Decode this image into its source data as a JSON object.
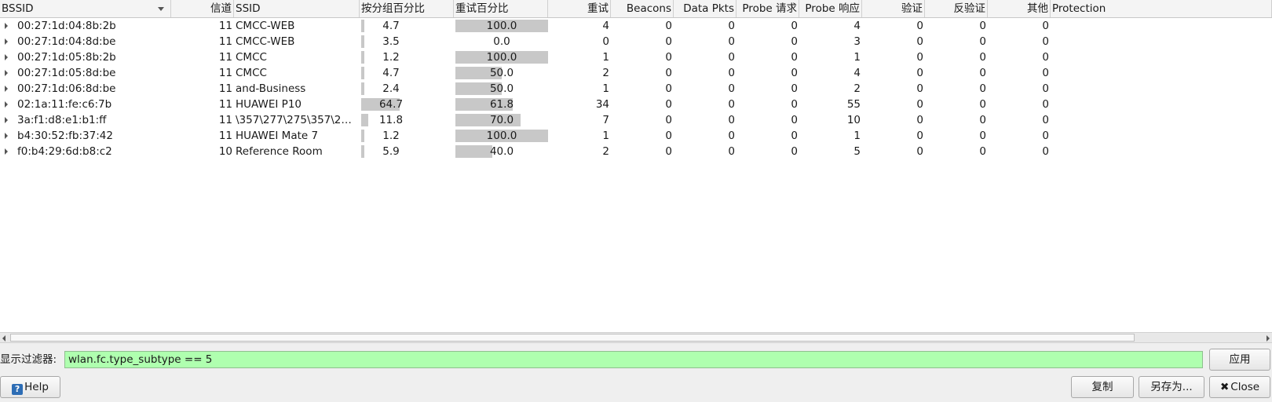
{
  "columns": [
    {
      "key": "bssid",
      "label": "BSSID"
    },
    {
      "key": "channel",
      "label": "信道"
    },
    {
      "key": "ssid",
      "label": "SSID"
    },
    {
      "key": "pct_packets",
      "label": "按分组百分比"
    },
    {
      "key": "pct_retry",
      "label": "重试百分比"
    },
    {
      "key": "retry",
      "label": "重试"
    },
    {
      "key": "beacons",
      "label": "Beacons"
    },
    {
      "key": "data_pkts",
      "label": "Data Pkts"
    },
    {
      "key": "probe_req",
      "label": "Probe 请求"
    },
    {
      "key": "probe_resp",
      "label": "Probe 响应"
    },
    {
      "key": "auth",
      "label": "验证"
    },
    {
      "key": "deauth",
      "label": "反验证"
    },
    {
      "key": "other",
      "label": "其他"
    },
    {
      "key": "protection",
      "label": "Protection"
    }
  ],
  "rows": [
    {
      "bssid": "00:27:1d:04:8b:2b",
      "channel": "11",
      "ssid": "CMCC-WEB",
      "pct_packets": "4.7",
      "pct_packets_value": 4.7,
      "pct_retry": "100.0",
      "pct_retry_value": 100.0,
      "retry": "4",
      "beacons": "0",
      "data_pkts": "0",
      "probe_req": "0",
      "probe_resp": "4",
      "auth": "0",
      "deauth": "0",
      "other": "0",
      "protection": ""
    },
    {
      "bssid": "00:27:1d:04:8d:be",
      "channel": "11",
      "ssid": "CMCC-WEB",
      "pct_packets": "3.5",
      "pct_packets_value": 3.5,
      "pct_retry": "0.0",
      "pct_retry_value": 0.0,
      "retry": "0",
      "beacons": "0",
      "data_pkts": "0",
      "probe_req": "0",
      "probe_resp": "3",
      "auth": "0",
      "deauth": "0",
      "other": "0",
      "protection": ""
    },
    {
      "bssid": "00:27:1d:05:8b:2b",
      "channel": "11",
      "ssid": "CMCC",
      "pct_packets": "1.2",
      "pct_packets_value": 1.2,
      "pct_retry": "100.0",
      "pct_retry_value": 100.0,
      "retry": "1",
      "beacons": "0",
      "data_pkts": "0",
      "probe_req": "0",
      "probe_resp": "1",
      "auth": "0",
      "deauth": "0",
      "other": "0",
      "protection": ""
    },
    {
      "bssid": "00:27:1d:05:8d:be",
      "channel": "11",
      "ssid": "CMCC",
      "pct_packets": "4.7",
      "pct_packets_value": 4.7,
      "pct_retry": "50.0",
      "pct_retry_value": 50.0,
      "retry": "2",
      "beacons": "0",
      "data_pkts": "0",
      "probe_req": "0",
      "probe_resp": "4",
      "auth": "0",
      "deauth": "0",
      "other": "0",
      "protection": ""
    },
    {
      "bssid": "00:27:1d:06:8d:be",
      "channel": "11",
      "ssid": "and-Business",
      "pct_packets": "2.4",
      "pct_packets_value": 2.4,
      "pct_retry": "50.0",
      "pct_retry_value": 50.0,
      "retry": "1",
      "beacons": "0",
      "data_pkts": "0",
      "probe_req": "0",
      "probe_resp": "2",
      "auth": "0",
      "deauth": "0",
      "other": "0",
      "protection": ""
    },
    {
      "bssid": "02:1a:11:fe:c6:7b",
      "channel": "11",
      "ssid": "HUAWEI P10",
      "pct_packets": "64.7",
      "pct_packets_value": 64.7,
      "pct_retry": "61.8",
      "pct_retry_value": 61.8,
      "retry": "34",
      "beacons": "0",
      "data_pkts": "0",
      "probe_req": "0",
      "probe_resp": "55",
      "auth": "0",
      "deauth": "0",
      "other": "0",
      "protection": ""
    },
    {
      "bssid": "3a:f1:d8:e1:b1:ff",
      "channel": "11",
      "ssid": "\\357\\277\\275\\357\\2…",
      "pct_packets": "11.8",
      "pct_packets_value": 11.8,
      "pct_retry": "70.0",
      "pct_retry_value": 70.0,
      "retry": "7",
      "beacons": "0",
      "data_pkts": "0",
      "probe_req": "0",
      "probe_resp": "10",
      "auth": "0",
      "deauth": "0",
      "other": "0",
      "protection": ""
    },
    {
      "bssid": "b4:30:52:fb:37:42",
      "channel": "11",
      "ssid": "HUAWEI Mate 7",
      "pct_packets": "1.2",
      "pct_packets_value": 1.2,
      "pct_retry": "100.0",
      "pct_retry_value": 100.0,
      "retry": "1",
      "beacons": "0",
      "data_pkts": "0",
      "probe_req": "0",
      "probe_resp": "1",
      "auth": "0",
      "deauth": "0",
      "other": "0",
      "protection": ""
    },
    {
      "bssid": "f0:b4:29:6d:b8:c2",
      "channel": "10",
      "ssid": "Reference Room",
      "pct_packets": "5.9",
      "pct_packets_value": 5.9,
      "pct_retry": "40.0",
      "pct_retry_value": 40.0,
      "retry": "2",
      "beacons": "0",
      "data_pkts": "0",
      "probe_req": "0",
      "probe_resp": "5",
      "auth": "0",
      "deauth": "0",
      "other": "0",
      "protection": ""
    }
  ],
  "filter": {
    "label": "显示过滤器:",
    "value": "wlan.fc.type_subtype == 5"
  },
  "buttons": {
    "apply": "应用",
    "help": "Help",
    "copy": "复制",
    "save_as": "另存为...",
    "close": "Close"
  },
  "icons": {
    "help": "help-icon",
    "close": "close-icon",
    "expander": "expander-triangle-icon",
    "sort": "sort-descending-icon"
  },
  "colors": {
    "filter_valid_bg": "#afffaf",
    "bar_fill": "#c8c8c8",
    "help_icon": "#2d6db5"
  }
}
